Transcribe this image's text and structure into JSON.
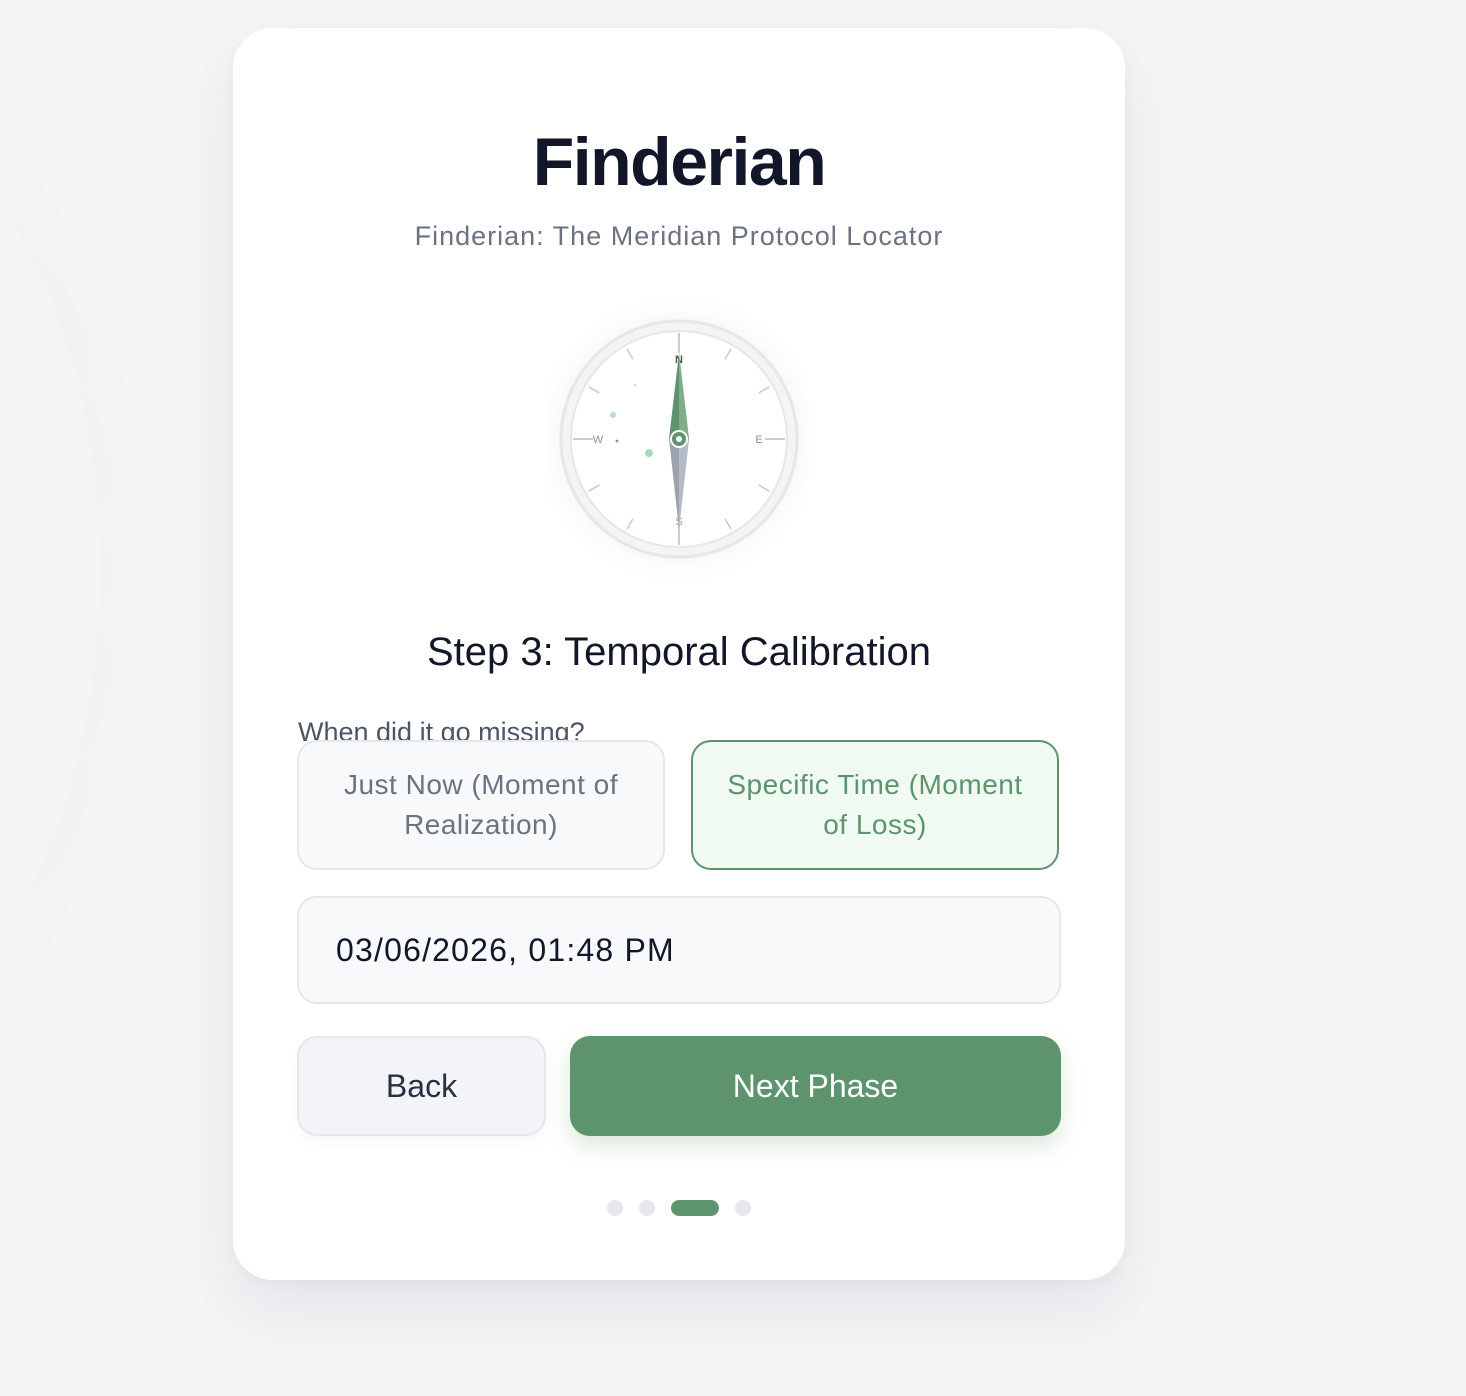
{
  "app": {
    "title": "Finderian",
    "subtitle": "Finderian: The Meridian Protocol Locator"
  },
  "compass": {
    "north_label": "N",
    "south_label": "S",
    "east_label": "E",
    "west_label": "W",
    "accent_color": "#5e946d"
  },
  "step": {
    "heading": "Step 3: Temporal Calibration",
    "question": "When did it go missing?"
  },
  "options": [
    {
      "label": "Just Now (Moment of Realization)",
      "selected": false
    },
    {
      "label": "Specific Time (Moment of Loss)",
      "selected": true
    }
  ],
  "datetime": {
    "value": "03/06/2026, 01:48 PM"
  },
  "buttons": {
    "back_label": "Back",
    "next_label": "Next Phase"
  },
  "progress": {
    "total_steps": 4,
    "current_step": 3
  },
  "colors": {
    "accent": "#5e946d",
    "text_dark": "#121629",
    "text_muted": "#6b7280"
  }
}
